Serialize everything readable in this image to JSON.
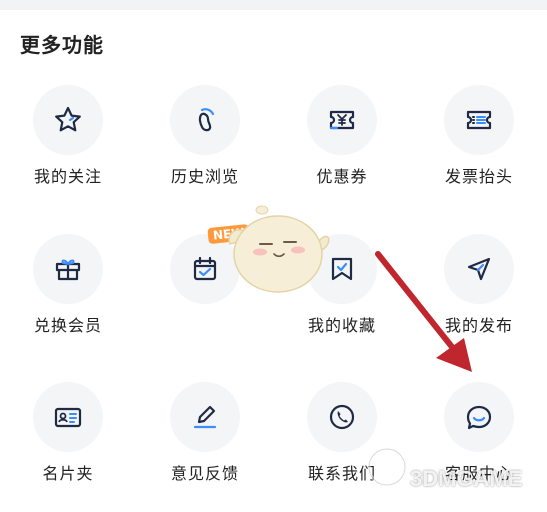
{
  "section_title": "更多功能",
  "items": [
    {
      "label": "我的关注",
      "icon": "star-icon"
    },
    {
      "label": "历史浏览",
      "icon": "footprint-icon"
    },
    {
      "label": "优惠券",
      "icon": "coupon-icon"
    },
    {
      "label": "发票抬头",
      "icon": "invoice-icon"
    },
    {
      "label": "兑换会员",
      "icon": "gift-icon"
    },
    {
      "label": "",
      "icon": "calendar-check-icon"
    },
    {
      "label": "我的收藏",
      "icon": "bookmark-icon"
    },
    {
      "label": "我的发布",
      "icon": "send-icon"
    },
    {
      "label": "名片夹",
      "icon": "business-card-icon"
    },
    {
      "label": "意见反馈",
      "icon": "edit-pen-icon"
    },
    {
      "label": "联系我们",
      "icon": "phone-icon"
    },
    {
      "label": "客服中心",
      "icon": "chat-bubble-icon"
    }
  ],
  "badge": {
    "new": "NEW"
  },
  "watermark": "3DMGAME",
  "colors": {
    "icon_dark": "#1f2a44",
    "icon_accent": "#3b8cff",
    "circle_bg": "#f4f5f7",
    "arrow": "#c0262d",
    "badge": "#ff9a3c"
  }
}
